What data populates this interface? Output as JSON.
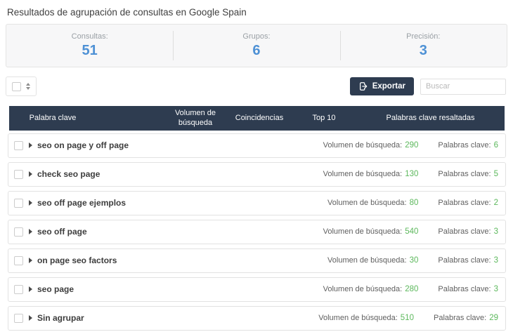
{
  "page": {
    "title": "Resultados de agrupación de consultas en Google Spain"
  },
  "stats": {
    "items": [
      {
        "label": "Consultas:",
        "value": "51"
      },
      {
        "label": "Grupos:",
        "value": "6"
      },
      {
        "label": "Precisión:",
        "value": "3"
      }
    ]
  },
  "toolbar": {
    "export_label": "Exportar",
    "search_placeholder": "Buscar"
  },
  "table": {
    "headers": [
      "Palabra clave",
      "Volumen de búsqueda",
      "Coincidencias",
      "Top 10",
      "Palabras clave resaltadas"
    ],
    "row_labels": {
      "volume": "Volumen de búsqueda:",
      "keywords": "Palabras clave:"
    },
    "rows": [
      {
        "name": "seo on page y off page",
        "volume": "290",
        "keywords": "6"
      },
      {
        "name": "check seo page",
        "volume": "130",
        "keywords": "5"
      },
      {
        "name": "seo off page ejemplos",
        "volume": "80",
        "keywords": "2"
      },
      {
        "name": "seo off page",
        "volume": "540",
        "keywords": "3"
      },
      {
        "name": "on page seo factors",
        "volume": "30",
        "keywords": "3"
      },
      {
        "name": "seo page",
        "volume": "280",
        "keywords": "3"
      },
      {
        "name": "Sin agrupar",
        "volume": "510",
        "keywords": "29"
      }
    ]
  },
  "colors": {
    "accent_blue": "#4e91d5",
    "value_green": "#5cb85c",
    "header_navy": "#2e3c50"
  }
}
